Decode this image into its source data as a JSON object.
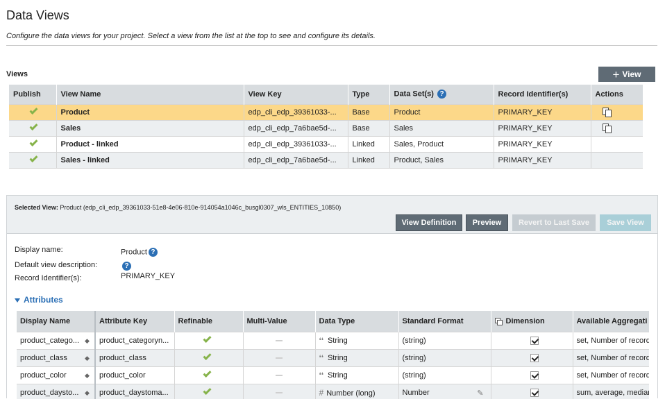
{
  "page": {
    "title": "Data Views",
    "subtitle": "Configure the data views for your project. Select a view from the list at the top to see and configure its details."
  },
  "views": {
    "label": "Views",
    "add_button": "View",
    "columns": [
      "Publish",
      "View Name",
      "View Key",
      "Type",
      "Data Set(s)",
      "Record Identifier(s)",
      "Actions"
    ],
    "rows": [
      {
        "name": "Product",
        "key": "edp_cli_edp_39361033-...",
        "type": "Base",
        "datasets": "Product",
        "record_id": "PRIMARY_KEY",
        "has_action": true,
        "selected": true
      },
      {
        "name": "Sales",
        "key": "edp_cli_edp_7a6bae5d-...",
        "type": "Base",
        "datasets": "Sales",
        "record_id": "PRIMARY_KEY",
        "has_action": true,
        "selected": false
      },
      {
        "name": "Product - linked",
        "key": "edp_cli_edp_39361033-...",
        "type": "Linked",
        "datasets": "Sales, Product",
        "record_id": "PRIMARY_KEY",
        "has_action": false,
        "selected": false
      },
      {
        "name": "Sales - linked",
        "key": "edp_cli_edp_7a6bae5d-...",
        "type": "Linked",
        "datasets": "Product, Sales",
        "record_id": "PRIMARY_KEY",
        "has_action": false,
        "selected": false
      }
    ]
  },
  "selected_view": {
    "label": "Selected View:",
    "value": "Product (edp_cli_edp_39361033-51e8-4e06-810e-914054a1046c_busgl0307_wls_ENTITIES_10850)",
    "buttons": {
      "view_definition": "View Definition",
      "preview": "Preview",
      "revert": "Revert to Last Save",
      "save": "Save View"
    },
    "display_name_label": "Display name:",
    "display_name_value": "Product",
    "description_label": "Default view description:",
    "record_id_label": "Record Identifier(s):",
    "record_id_value": "PRIMARY_KEY"
  },
  "attributes": {
    "toggle_label": "Attributes",
    "columns": [
      "Display Name",
      "Attribute Key",
      "Refinable",
      "Multi-Value",
      "Data Type",
      "Standard Format",
      "Dimension",
      "Available Aggregati"
    ],
    "rows": [
      {
        "display": "product_catego...",
        "key": "product_categoryn...",
        "refinable": true,
        "data_type": "String",
        "format": "(string)",
        "dimension": true,
        "aggregations": "set, Number of records"
      },
      {
        "display": "product_class",
        "key": "product_class",
        "refinable": true,
        "data_type": "String",
        "format": "(string)",
        "dimension": true,
        "aggregations": "set, Number of records"
      },
      {
        "display": "product_color",
        "key": "product_color",
        "refinable": true,
        "data_type": "String",
        "format": "(string)",
        "dimension": true,
        "aggregations": "set, Number of records"
      },
      {
        "display": "product_daysto...",
        "key": "product_daystoma...",
        "refinable": true,
        "data_type": "Number (long)",
        "format": "Number",
        "dimension": true,
        "aggregations": "sum, average, median"
      }
    ]
  },
  "colors": {
    "selected_row": "#fcd889",
    "header_bg": "#d8dcdf",
    "check_green": "#86b34a",
    "link_blue": "#2b6fb5",
    "dark_button": "#5f6b75"
  }
}
